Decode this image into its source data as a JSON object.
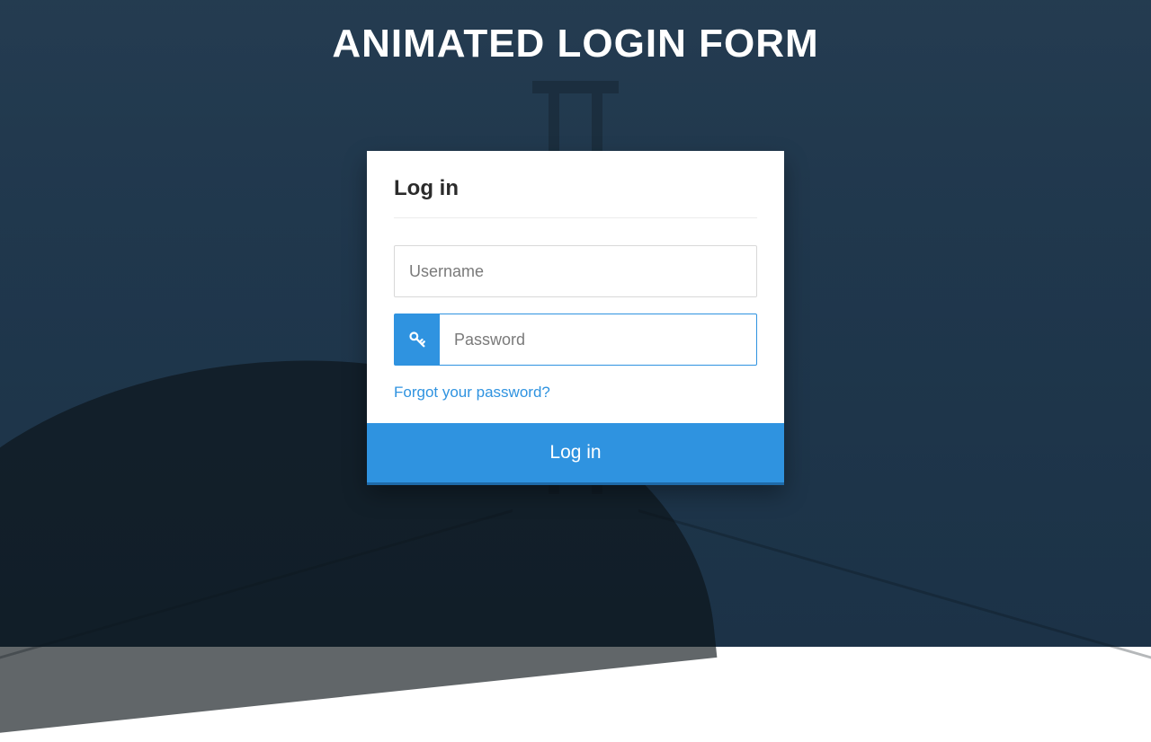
{
  "page": {
    "heading": "ANIMATED LOGIN FORM"
  },
  "card": {
    "title": "Log in",
    "username": {
      "placeholder": "Username",
      "value": ""
    },
    "password": {
      "placeholder": "Password",
      "value": "",
      "icon": "key-icon"
    },
    "forgot_label": "Forgot your password?",
    "submit_label": "Log in"
  },
  "colors": {
    "accent": "#2f93e0",
    "overlay": "#1b3246"
  }
}
